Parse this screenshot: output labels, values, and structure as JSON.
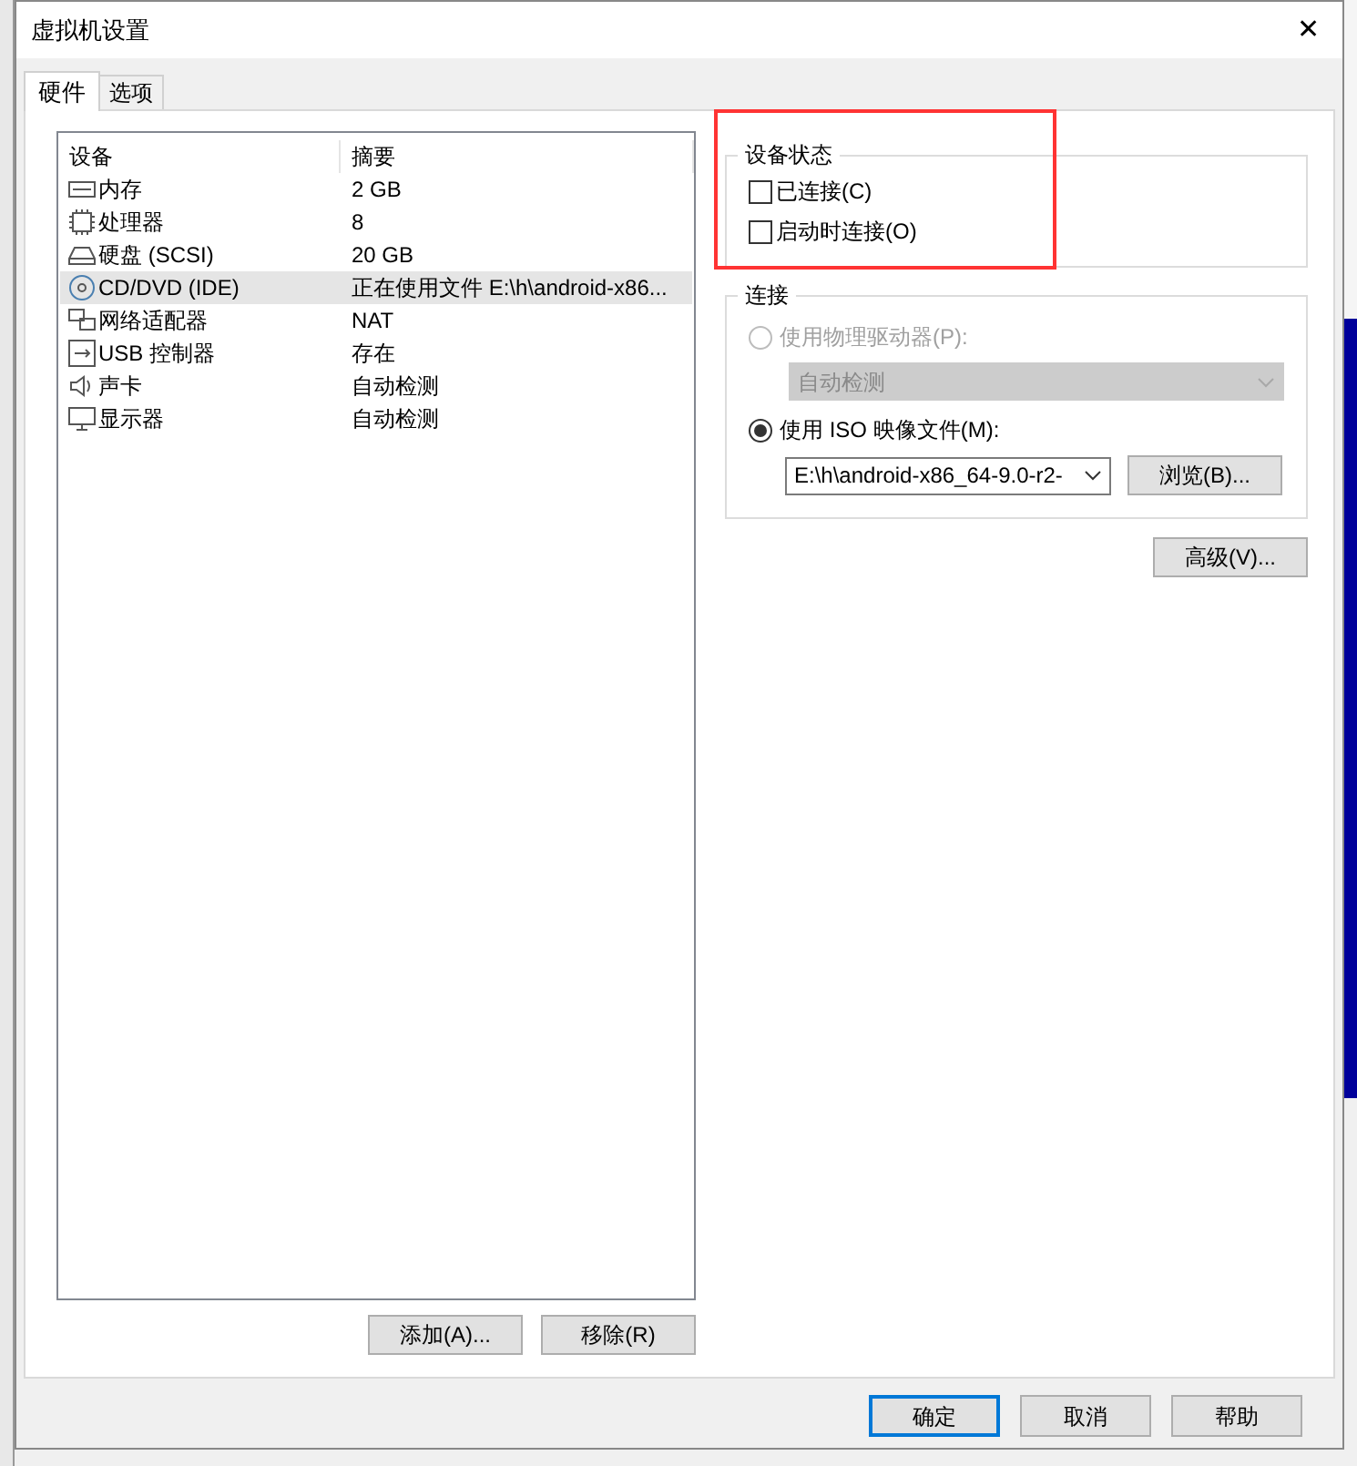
{
  "window": {
    "title": "虚拟机设置",
    "close": "✕"
  },
  "tabs": [
    {
      "label": "硬件",
      "selected": true
    },
    {
      "label": "选项",
      "selected": false
    }
  ],
  "device_list": {
    "columns": [
      "设备",
      "摘要"
    ],
    "rows": [
      {
        "kind": "memory",
        "device": "内存",
        "summary": "2 GB",
        "selected": false
      },
      {
        "kind": "cpu",
        "device": "处理器",
        "summary": "8",
        "selected": false
      },
      {
        "kind": "disk",
        "device": "硬盘 (SCSI)",
        "summary": "20 GB",
        "selected": false
      },
      {
        "kind": "cdrom",
        "device": "CD/DVD (IDE)",
        "summary": "正在使用文件 E:\\h\\android-x86...",
        "selected": true
      },
      {
        "kind": "network",
        "device": "网络适配器",
        "summary": "NAT",
        "selected": false
      },
      {
        "kind": "usb",
        "device": "USB 控制器",
        "summary": "存在",
        "selected": false
      },
      {
        "kind": "sound",
        "device": "声卡",
        "summary": "自动检测",
        "selected": false
      },
      {
        "kind": "display",
        "device": "显示器",
        "summary": "自动检测",
        "selected": false
      }
    ]
  },
  "list_buttons": [
    "添加(A)...",
    "移除(R)"
  ],
  "device_status": {
    "title": "设备状态",
    "options": [
      {
        "label": "已连接(C)",
        "checked": false
      },
      {
        "label": "启动时连接(O)",
        "checked": false
      }
    ]
  },
  "connection": {
    "title": "连接",
    "physical": {
      "label": "使用物理驱动器(P):",
      "selected": false,
      "disabled": true,
      "drive": "自动检测"
    },
    "iso": {
      "label": "使用 ISO 映像文件(M):",
      "selected": true,
      "disabled": false,
      "file": "E:\\h\\android-x86_64-9.0-r2-",
      "browse": "浏览(B)..."
    }
  },
  "advanced_button": "高级(V)...",
  "dialog_buttons": [
    {
      "label": "确定",
      "default": true
    },
    {
      "label": "取消",
      "default": false
    },
    {
      "label": "帮助",
      "default": false
    }
  ]
}
